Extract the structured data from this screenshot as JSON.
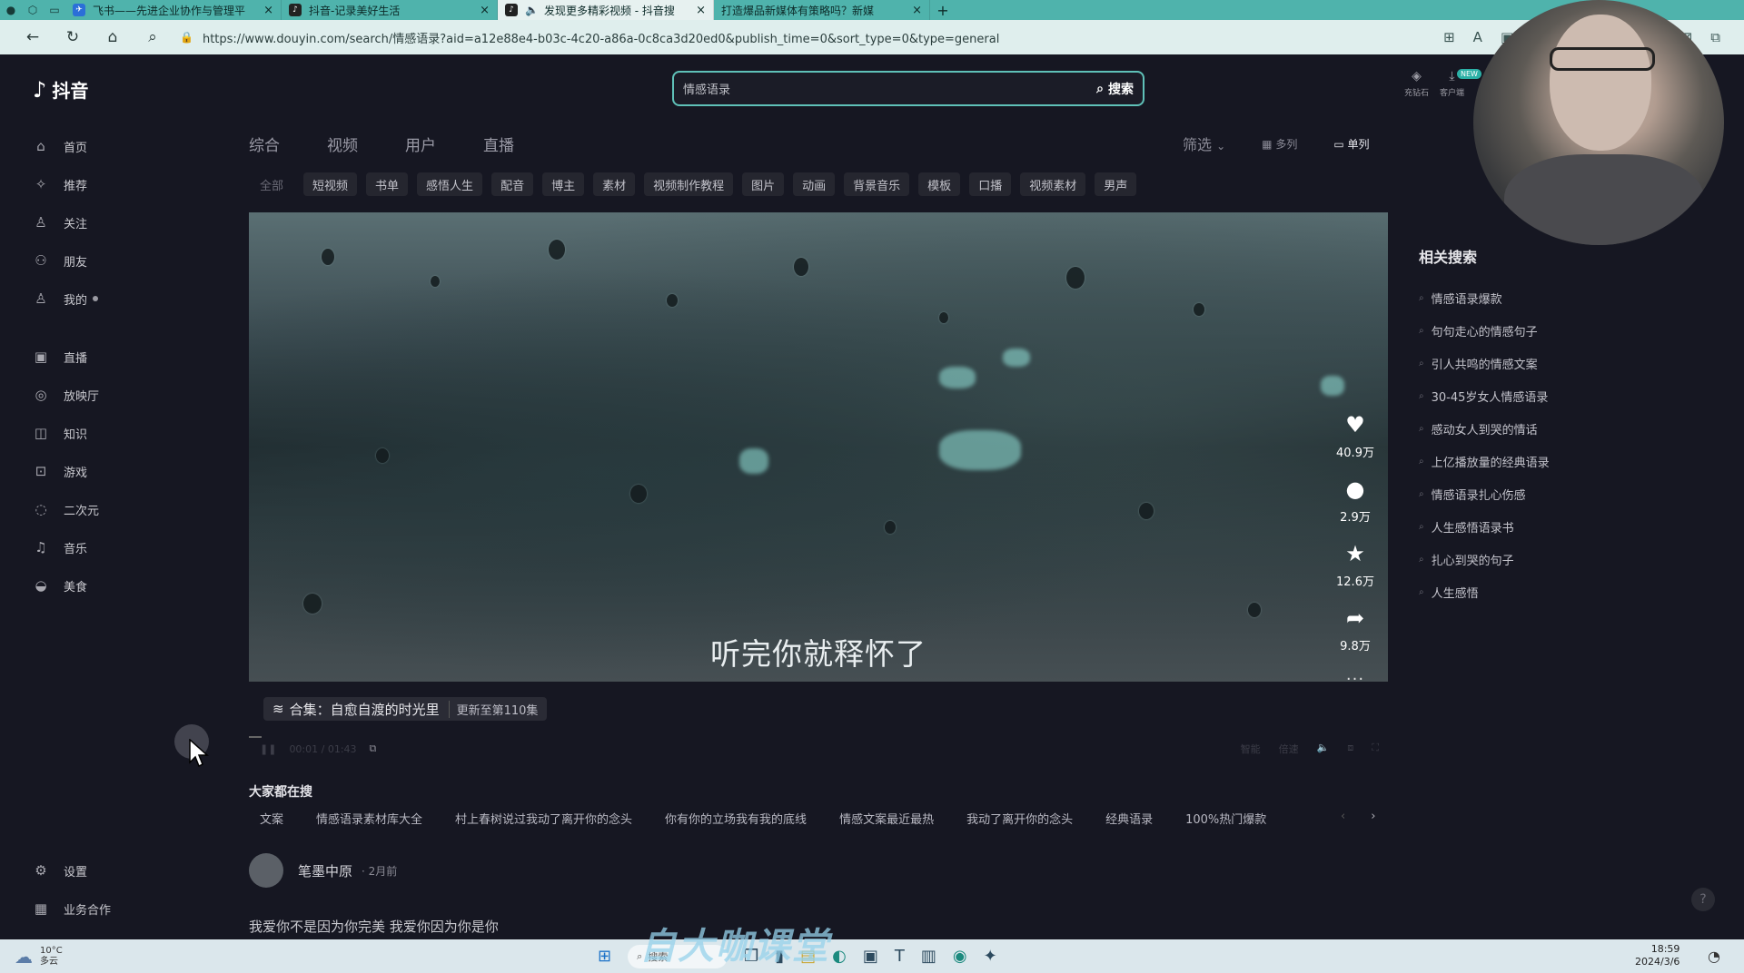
{
  "browser": {
    "tabs": [
      {
        "title": "飞书——先进企业协作与管理平",
        "active": false
      },
      {
        "title": "抖音-记录美好生活",
        "active": false
      },
      {
        "title": "发现更多精彩视频 - 抖音搜",
        "active": true
      },
      {
        "title": "打造爆品新媒体有策略吗？新媒",
        "active": false
      }
    ],
    "url": "https://www.douyin.com/search/情感语录?aid=a12e88e4-b03c-4c20-a86a-0c8ca3d20ed0&publish_time=0&sort_type=0&type=general"
  },
  "app": {
    "logo_text": "抖音"
  },
  "sidebar": {
    "items": [
      {
        "label": "首页",
        "icon": "home-icon",
        "glyph": "⌂"
      },
      {
        "label": "推荐",
        "icon": "recommend-icon",
        "glyph": "✧"
      },
      {
        "label": "关注",
        "icon": "follow-icon",
        "glyph": "♙"
      },
      {
        "label": "朋友",
        "icon": "friends-icon",
        "glyph": "⚇"
      },
      {
        "label": "我的",
        "icon": "profile-icon",
        "glyph": "♙"
      }
    ],
    "items2": [
      {
        "label": "直播",
        "icon": "live-icon",
        "glyph": "▣"
      },
      {
        "label": "放映厅",
        "icon": "cinema-icon",
        "glyph": "◎"
      },
      {
        "label": "知识",
        "icon": "knowledge-icon",
        "glyph": "◫"
      },
      {
        "label": "游戏",
        "icon": "game-icon",
        "glyph": "⊡"
      },
      {
        "label": "二次元",
        "icon": "anime-icon",
        "glyph": "◌"
      },
      {
        "label": "音乐",
        "icon": "music-icon",
        "glyph": "♫"
      },
      {
        "label": "美食",
        "icon": "food-icon",
        "glyph": "◒"
      }
    ],
    "bottom": [
      {
        "label": "设置",
        "icon": "settings-icon",
        "glyph": "⚙"
      },
      {
        "label": "业务合作",
        "icon": "business-icon",
        "glyph": "▦"
      }
    ]
  },
  "search": {
    "value": "情感语录",
    "button_label": "搜索"
  },
  "topright": {
    "recharge": "充钻石",
    "client": "客户端",
    "new_badge": "NEW"
  },
  "type_tabs": [
    "综合",
    "视频",
    "用户",
    "直播"
  ],
  "view": {
    "filter": "筛选",
    "multi": "多列",
    "single": "单列"
  },
  "chips": [
    "全部",
    "短视频",
    "书单",
    "感悟人生",
    "配音",
    "博主",
    "素材",
    "视频制作教程",
    "图片",
    "动画",
    "背景音乐",
    "模板",
    "口播",
    "视频素材",
    "男声"
  ],
  "video": {
    "subtitle": "听完你就释怀了",
    "likes": "40.9万",
    "comments": "2.9万",
    "favorites": "12.6万",
    "shares": "9.8万",
    "collection_label": "合集：自愈自渡的时光里",
    "collection_update": "更新至第110集",
    "time": "00:01 / 01:43",
    "controls": [
      "智能",
      "倍速"
    ]
  },
  "hot_search": {
    "heading": "大家都在搜",
    "items": [
      "文案",
      "情感语录素材库大全",
      "村上春树说过我动了离开你的念头",
      "你有你的立场我有我的底线",
      "情感文案最近最热",
      "我动了离开你的念头",
      "经典语录",
      "100%热门爆款"
    ]
  },
  "post": {
    "author": "笔墨中原",
    "time": "2月前",
    "desc": "我爱你不是因为你完美 我爱你因为你是你"
  },
  "related": {
    "heading": "相关搜索",
    "items": [
      "情感语录爆款",
      "句句走心的情感句子",
      "引人共鸣的情感文案",
      "30-45岁女人情感语录",
      "感动女人到哭的情话",
      "上亿播放量的经典语录",
      "情感语录扎心伤感",
      "人生感悟语录书",
      "扎心到哭的句子",
      "人生感悟"
    ]
  },
  "taskbar": {
    "temp": "10°C",
    "weather": "多云",
    "search": "搜索",
    "time": "18:59",
    "date": "2024/3/6"
  },
  "watermark": "自大咖课堂"
}
